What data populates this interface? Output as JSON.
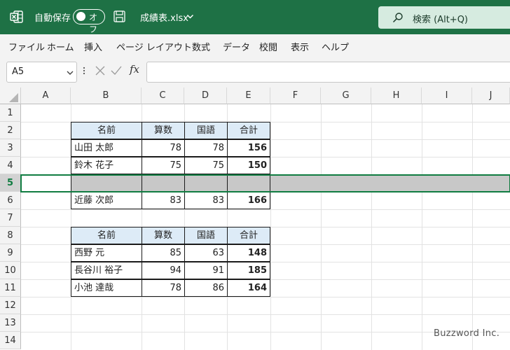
{
  "title_bar": {
    "autosave_label": "自動保存",
    "autosave_state": "オフ",
    "filename": "成績表.xlsx",
    "search_placeholder": "検索 (Alt+Q)",
    "brand_color": "#1e7145"
  },
  "menu": [
    "ファイル",
    "ホーム",
    "挿入",
    "ページ レイアウト",
    "数式",
    "データ",
    "校閲",
    "表示",
    "ヘルプ"
  ],
  "formula_bar": {
    "name_box": "A5",
    "fx_label": "fx",
    "formula": ""
  },
  "columns": [
    "A",
    "B",
    "C",
    "D",
    "E",
    "F",
    "G",
    "H",
    "I",
    "J"
  ],
  "rows": [
    "1",
    "2",
    "3",
    "4",
    "5",
    "6",
    "7",
    "8",
    "9",
    "10",
    "11",
    "12",
    "13",
    "14"
  ],
  "selected_row": "5",
  "table1": {
    "headers": [
      "名前",
      "算数",
      "国語",
      "合計"
    ],
    "rows": [
      [
        "山田 太郎",
        "78",
        "78",
        "156"
      ],
      [
        "鈴木 花子",
        "75",
        "75",
        "150"
      ],
      [
        "",
        "",
        "",
        ""
      ],
      [
        "近藤 次郎",
        "83",
        "83",
        "166"
      ]
    ]
  },
  "table2": {
    "headers": [
      "名前",
      "算数",
      "国語",
      "合計"
    ],
    "rows": [
      [
        "西野 元",
        "85",
        "63",
        "148"
      ],
      [
        "長谷川 裕子",
        "94",
        "91",
        "185"
      ],
      [
        "小池 達哉",
        "78",
        "86",
        "164"
      ]
    ]
  },
  "watermark": "Buzzword Inc."
}
